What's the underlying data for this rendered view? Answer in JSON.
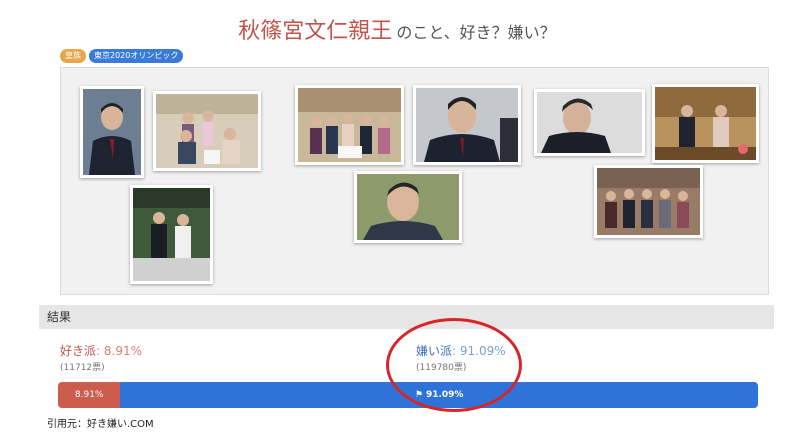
{
  "title": {
    "name": "秋篠宮文仁親王",
    "rest": "のこと、好き？嫌い？"
  },
  "tags": [
    "皇族",
    "東京2020オリンピック"
  ],
  "gallery": {
    "photo_count": 10
  },
  "results": {
    "header": "結果",
    "like": {
      "label": "好き派",
      "percent": "8.91%",
      "votes": "(11712票)"
    },
    "dislike": {
      "label": "嫌い派",
      "percent": "91.09%",
      "votes": "(119780票)"
    },
    "bar": {
      "like_text": "8.91%",
      "dislike_text": "91.09%",
      "like_fraction": 0.0891
    }
  },
  "citation": "引用元：好き嫌い.COM",
  "colors": {
    "accent": "#c2544a",
    "dislike": "#2f73d9",
    "ring": "#d7262a"
  }
}
